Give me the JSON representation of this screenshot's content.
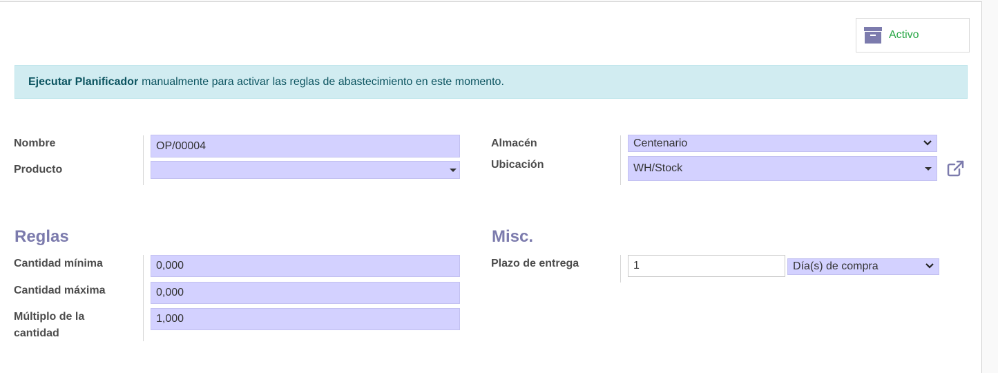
{
  "status": {
    "label": "Activo"
  },
  "alert": {
    "bold": "Ejecutar Planificador",
    "text": "manualmente para activar las reglas de abastecimiento en este momento."
  },
  "main_fields": {
    "nombre_label": "Nombre",
    "nombre_value": "OP/00004",
    "producto_label": "Producto",
    "producto_value": "",
    "almacen_label": "Almacén",
    "almacen_value": "Centenario",
    "ubicacion_label": "Ubicación",
    "ubicacion_value": "WH/Stock"
  },
  "reglas": {
    "title": "Reglas",
    "cant_min_label": "Cantidad mínima",
    "cant_min_value": "0,000",
    "cant_max_label": "Cantidad máxima",
    "cant_max_value": "0,000",
    "multiplo_label_1": "Múltiplo de la",
    "multiplo_label_2": "cantidad",
    "multiplo_value": "1,000"
  },
  "misc": {
    "title": "Misc.",
    "plazo_label": "Plazo de entrega",
    "plazo_value": "1",
    "plazo_unit": "Día(s) de compra"
  },
  "icons": {
    "status": "archive-box-icon",
    "external": "external-link-icon",
    "dropdown": "chevron-down-icon"
  },
  "colors": {
    "accent": "#7c7bad",
    "field_bg": "#d3d1ff",
    "alert_bg": "#d1ecf1",
    "active_green": "#28a745"
  }
}
